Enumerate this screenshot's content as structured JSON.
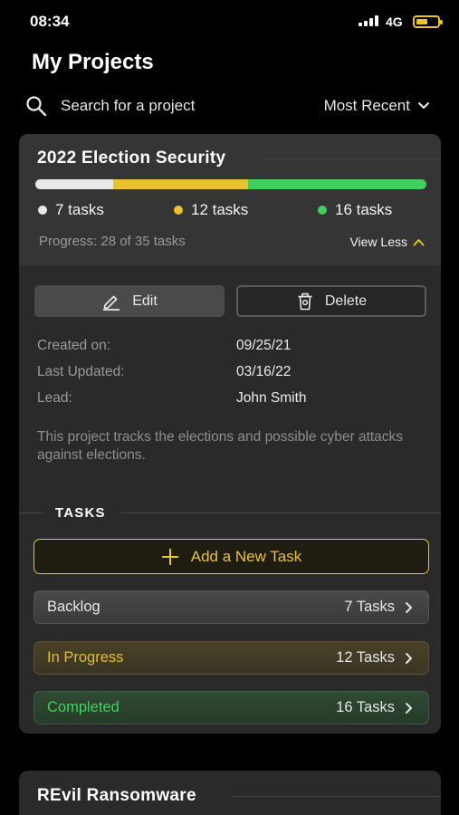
{
  "status_bar": {
    "time": "08:34",
    "network": "4G",
    "battery_color": "#e9c22d"
  },
  "page_title": "My Projects",
  "search": {
    "placeholder": "Search for a project",
    "icon": "search-icon"
  },
  "sort": {
    "label": "Most Recent",
    "icon": "chevron-down-icon"
  },
  "projects": [
    {
      "title": "2022 Election Security",
      "progress_segments": [
        {
          "label": "7 tasks",
          "count": 7,
          "color": "#e9e9e9"
        },
        {
          "label": "12 tasks",
          "count": 12,
          "color": "#e9c22d"
        },
        {
          "label": "16 tasks",
          "count": 16,
          "color": "#3fcf5c"
        }
      ],
      "progress_text": "Progress: 28 of 35 tasks",
      "toggle_label": "View Less",
      "actions": {
        "edit_label": "Edit",
        "delete_label": "Delete"
      },
      "meta": {
        "created_label": "Created on:",
        "created_value": "09/25/21",
        "updated_label": "Last Updated:",
        "updated_value": "03/16/22",
        "lead_label": "Lead:",
        "lead_value": "John Smith"
      },
      "description": "This project tracks the elections and possible cyber attacks against elections.",
      "tasks_heading": "TASKS",
      "add_task_label": "Add a New Task",
      "task_groups": [
        {
          "name": "Backlog",
          "count_label": "7 Tasks"
        },
        {
          "name": "In Progress",
          "count_label": "12 Tasks"
        },
        {
          "name": "Completed",
          "count_label": "16 Tasks"
        }
      ]
    },
    {
      "title": "REvil Ransomware"
    }
  ]
}
